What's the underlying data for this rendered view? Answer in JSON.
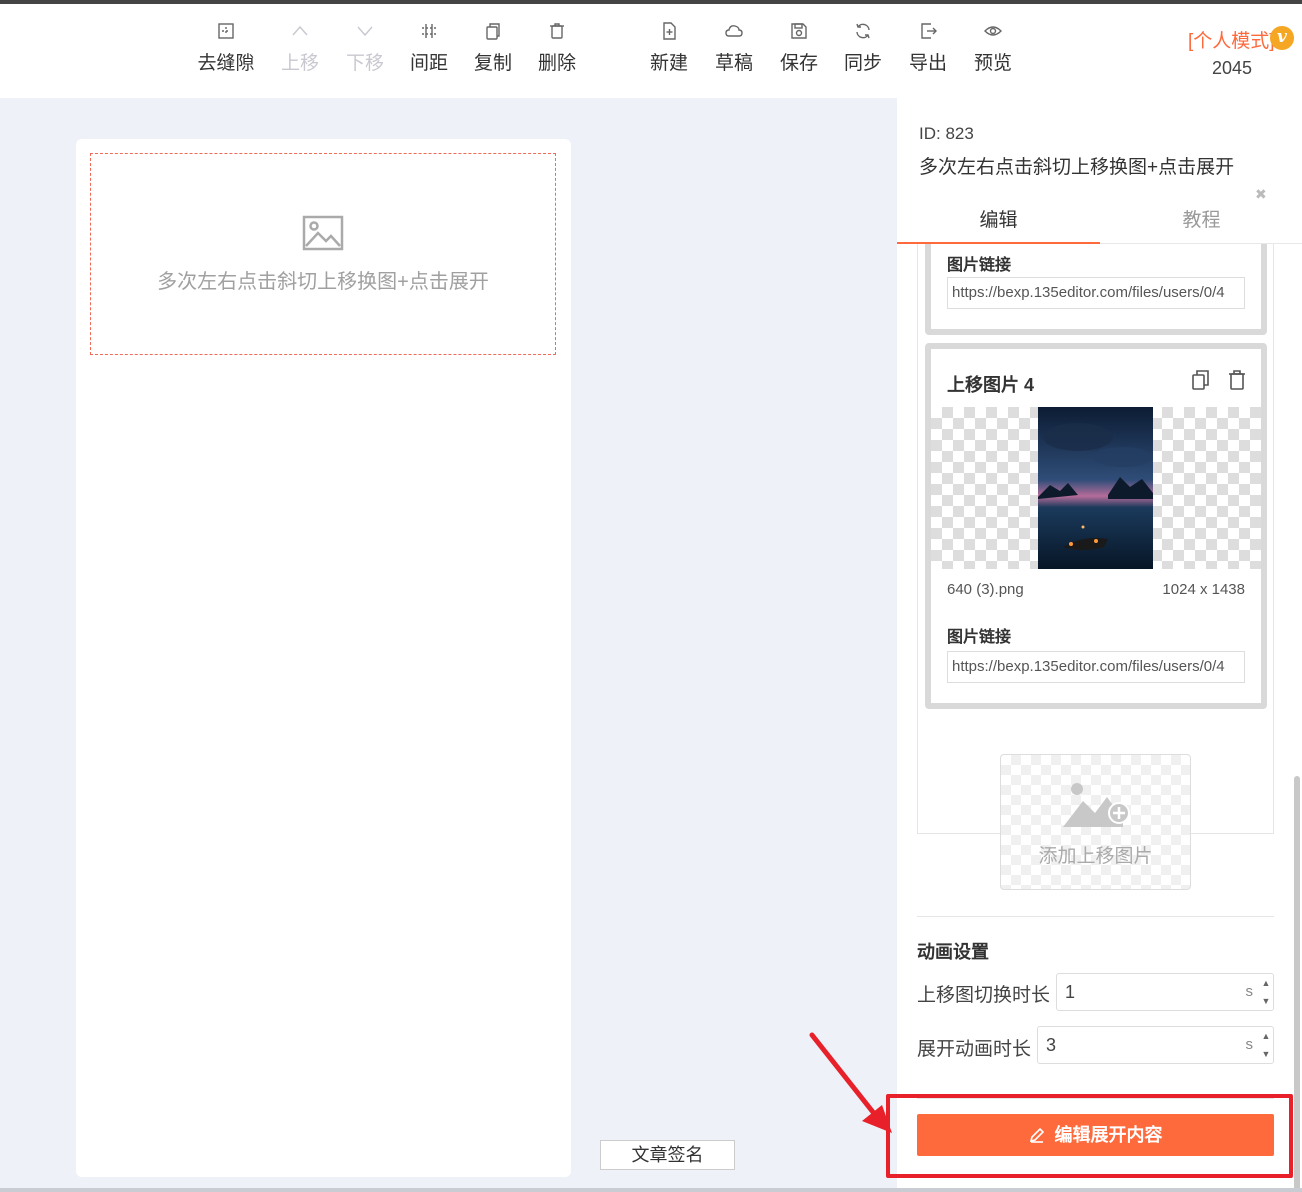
{
  "toolbar": {
    "items": [
      {
        "label": "去缝隙",
        "icon": "remove-gap-icon",
        "enabled": true
      },
      {
        "label": "上移",
        "icon": "chevron-up-icon",
        "enabled": false
      },
      {
        "label": "下移",
        "icon": "chevron-down-icon",
        "enabled": false
      },
      {
        "label": "间距",
        "icon": "spacing-icon",
        "enabled": true
      },
      {
        "label": "复制",
        "icon": "copy-icon",
        "enabled": true
      },
      {
        "label": "删除",
        "icon": "trash-icon",
        "enabled": true
      },
      {
        "label": "新建",
        "icon": "new-file-icon",
        "enabled": true
      },
      {
        "label": "草稿",
        "icon": "cloud-icon",
        "enabled": true
      },
      {
        "label": "保存",
        "icon": "save-icon",
        "enabled": true
      },
      {
        "label": "同步",
        "icon": "sync-icon",
        "enabled": true
      },
      {
        "label": "导出",
        "icon": "export-icon",
        "enabled": true
      },
      {
        "label": "预览",
        "icon": "eye-icon",
        "enabled": true
      }
    ],
    "mode_label": "[个人模式]",
    "vip_badge": "v",
    "user_count": "2045"
  },
  "canvas": {
    "placeholder_text": "多次左右点击斜切上移换图+点击展开",
    "signature_button": "文章签名"
  },
  "panel": {
    "id_label": "ID: 823",
    "title": "多次左右点击斜切上移换图+点击展开",
    "tabs": [
      {
        "label": "编辑",
        "active": true
      },
      {
        "label": "教程",
        "active": false
      }
    ],
    "cards": [
      {
        "link_label": "图片链接",
        "link_value": "https://bexp.135editor.com/files/users/0/4"
      },
      {
        "title": "上移图片 4",
        "file_name": "640 (3).png",
        "dimensions": "1024 x 1438",
        "link_label": "图片链接",
        "link_value": "https://bexp.135editor.com/files/users/0/4"
      }
    ],
    "add_image_label": "添加上移图片",
    "animation": {
      "section_title": "动画设置",
      "fields": [
        {
          "label": "上移图切换时长",
          "value": "1",
          "unit": "s"
        },
        {
          "label": "展开动画时长",
          "value": "3",
          "unit": "s"
        }
      ]
    },
    "edit_button": "编辑展开内容"
  },
  "colors": {
    "accent": "#ff6a3d",
    "highlight": "#e8202a",
    "background": "#eef1f7"
  }
}
